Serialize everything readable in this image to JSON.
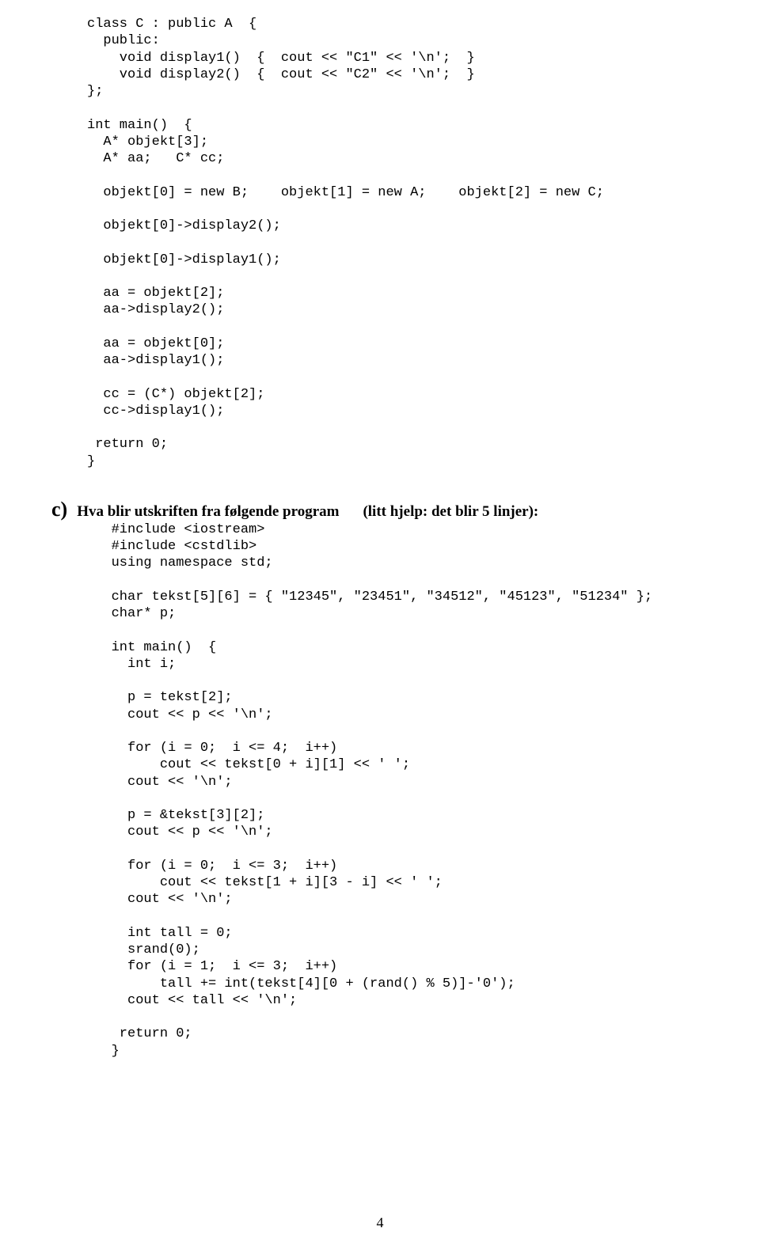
{
  "code_block_top": "class C : public A  {\n  public:\n    void display1()  {  cout << \"C1\" << '\\n';  }\n    void display2()  {  cout << \"C2\" << '\\n';  }\n};\n\nint main()  {\n  A* objekt[3];\n  A* aa;   C* cc;\n\n  objekt[0] = new B;    objekt[1] = new A;    objekt[2] = new C;\n\n  objekt[0]->display2();\n\n  objekt[0]->display1();\n\n  aa = objekt[2];\n  aa->display2();\n\n  aa = objekt[0];\n  aa->display1();\n\n  cc = (C*) objekt[2];\n  cc->display1();\n\n return 0;\n}",
  "question": {
    "label": "c)",
    "text": "Hva blir utskriften fra følgende program",
    "hint": "(litt hjelp: det blir 5 linjer):"
  },
  "code_block_bottom": "   #include <iostream>\n   #include <cstdlib>\n   using namespace std;\n\n   char tekst[5][6] = { \"12345\", \"23451\", \"34512\", \"45123\", \"51234\" };\n   char* p;\n\n   int main()  {\n     int i;\n\n     p = tekst[2];\n     cout << p << '\\n';\n\n     for (i = 0;  i <= 4;  i++)\n         cout << tekst[0 + i][1] << ' ';\n     cout << '\\n';\n\n     p = &tekst[3][2];\n     cout << p << '\\n';\n\n     for (i = 0;  i <= 3;  i++)\n         cout << tekst[1 + i][3 - i] << ' ';\n     cout << '\\n';\n\n     int tall = 0;\n     srand(0);\n     for (i = 1;  i <= 3;  i++)\n         tall += int(tekst[4][0 + (rand() % 5)]-'0');\n     cout << tall << '\\n';\n\n    return 0;\n   }",
  "page_number": "4"
}
